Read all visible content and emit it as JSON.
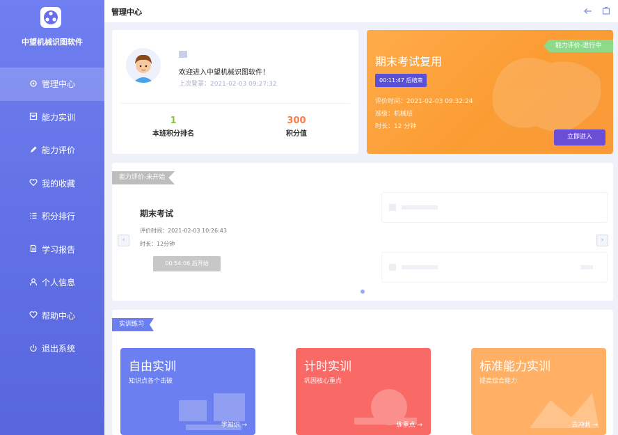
{
  "app": {
    "brand": "中望机械识图软件"
  },
  "topbar": {
    "title": "管理中心"
  },
  "sidebar": {
    "items": [
      {
        "label": "管理中心",
        "icon": "gear-icon",
        "active": true
      },
      {
        "label": "能力实训",
        "icon": "calendar-icon",
        "active": false
      },
      {
        "label": "能力评价",
        "icon": "pencil-icon",
        "active": false
      },
      {
        "label": "我的收藏",
        "icon": "heart-icon",
        "active": false
      },
      {
        "label": "积分排行",
        "icon": "list-icon",
        "active": false
      },
      {
        "label": "学习报告",
        "icon": "document-icon",
        "active": false
      },
      {
        "label": "个人信息",
        "icon": "user-icon",
        "active": false
      },
      {
        "label": "帮助中心",
        "icon": "heart-icon",
        "active": false
      },
      {
        "label": "退出系统",
        "icon": "power-icon",
        "active": false
      }
    ]
  },
  "welcome": {
    "greeting": "欢迎进入中望机械识图软件！",
    "last_login": "上次登录：2021-02-03 09:27:32",
    "rank_value": "1",
    "rank_label": "本班积分排名",
    "points_value": "300",
    "points_label": "积分值",
    "rank_color": "#8bc34a",
    "points_color": "#ff7a45"
  },
  "exam_card": {
    "ribbon": "能力评价-进行中",
    "title": "期末考试复用",
    "countdown": "00:11:47 后结束",
    "eval_time": "评价时间：2021-02-03 09:32:24",
    "class": "班级：机械班",
    "duration": "时长：12 分钟",
    "enter_button": "立即进入"
  },
  "evaluation": {
    "tag": "能力评价-未开始",
    "item_title": "期末考试",
    "eval_time": "评价时间：2021-02-03 10:26:43",
    "duration": "时长：12分钟",
    "start_button": "00:54:06 后开始"
  },
  "training": {
    "tag": "实训练习",
    "cards": [
      {
        "title": "自由实训",
        "subtitle": "知识点各个击破",
        "link": "学知识 →",
        "color": "#6c7ff0"
      },
      {
        "title": "计时实训",
        "subtitle": "巩固核心重点",
        "link": "练重点 →",
        "color": "#f96a66"
      },
      {
        "title": "标准能力实训",
        "subtitle": "提高综合能力",
        "link": "去冲刺 →",
        "color": "#ffb064"
      }
    ]
  },
  "colors": {
    "sidebar": "#6272e6",
    "accent": "#6a4fd6",
    "tag_gray": "#bdbdbd",
    "tag_blue": "#6b7ff0"
  }
}
